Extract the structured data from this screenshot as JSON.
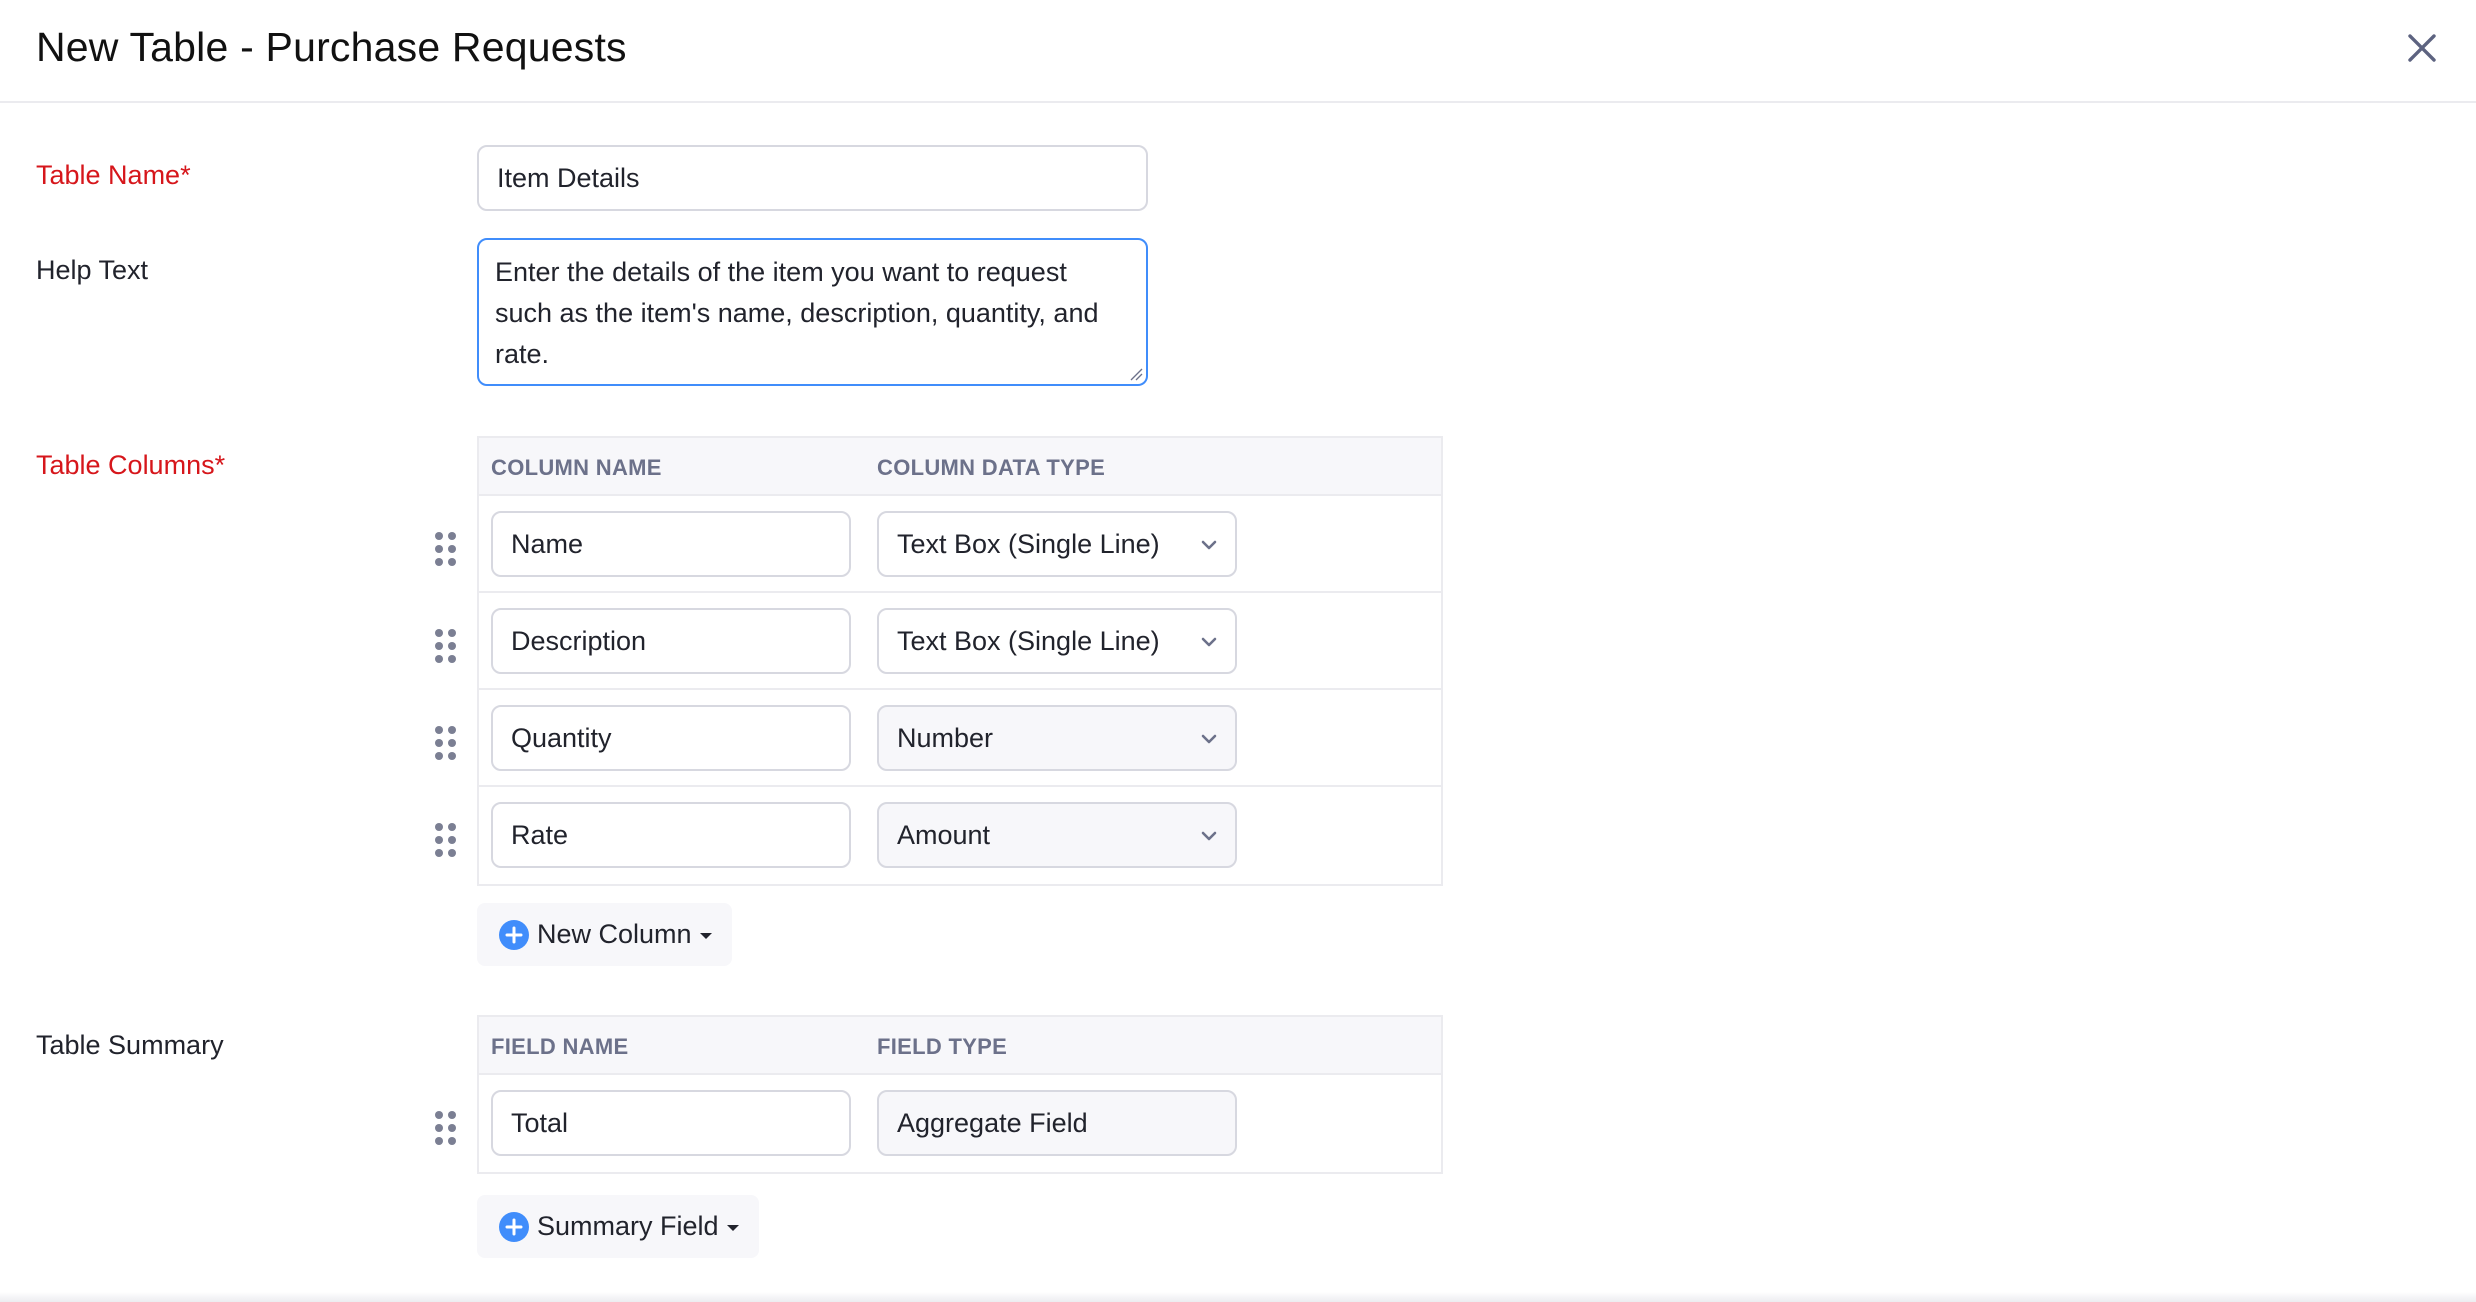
{
  "header": {
    "title": "New Table - Purchase Requests",
    "close_icon": "close-icon"
  },
  "form": {
    "table_name": {
      "label": "Table Name*",
      "value": "Item Details"
    },
    "help_text": {
      "label": "Help Text",
      "value": "Enter the details of the item you want to request such as the item's name, description, quantity, and rate."
    },
    "table_columns": {
      "label": "Table Columns*",
      "headers": [
        "COLUMN NAME",
        "COLUMN DATA TYPE"
      ],
      "rows": [
        {
          "name": "Name",
          "type": "Text Box (Single Line)"
        },
        {
          "name": "Description",
          "type": "Text Box (Single Line)"
        },
        {
          "name": "Quantity",
          "type": "Number"
        },
        {
          "name": "Rate",
          "type": "Amount"
        }
      ],
      "add_button": "New Column"
    },
    "table_summary": {
      "label": "Table Summary",
      "headers": [
        "FIELD NAME",
        "FIELD TYPE"
      ],
      "rows": [
        {
          "name": "Total",
          "type": "Aggregate Field"
        }
      ],
      "add_button": "Summary Field"
    }
  },
  "colors": {
    "required_label": "#d6161b",
    "focus_border": "#408dfb",
    "accent_plus": "#408dfb"
  }
}
